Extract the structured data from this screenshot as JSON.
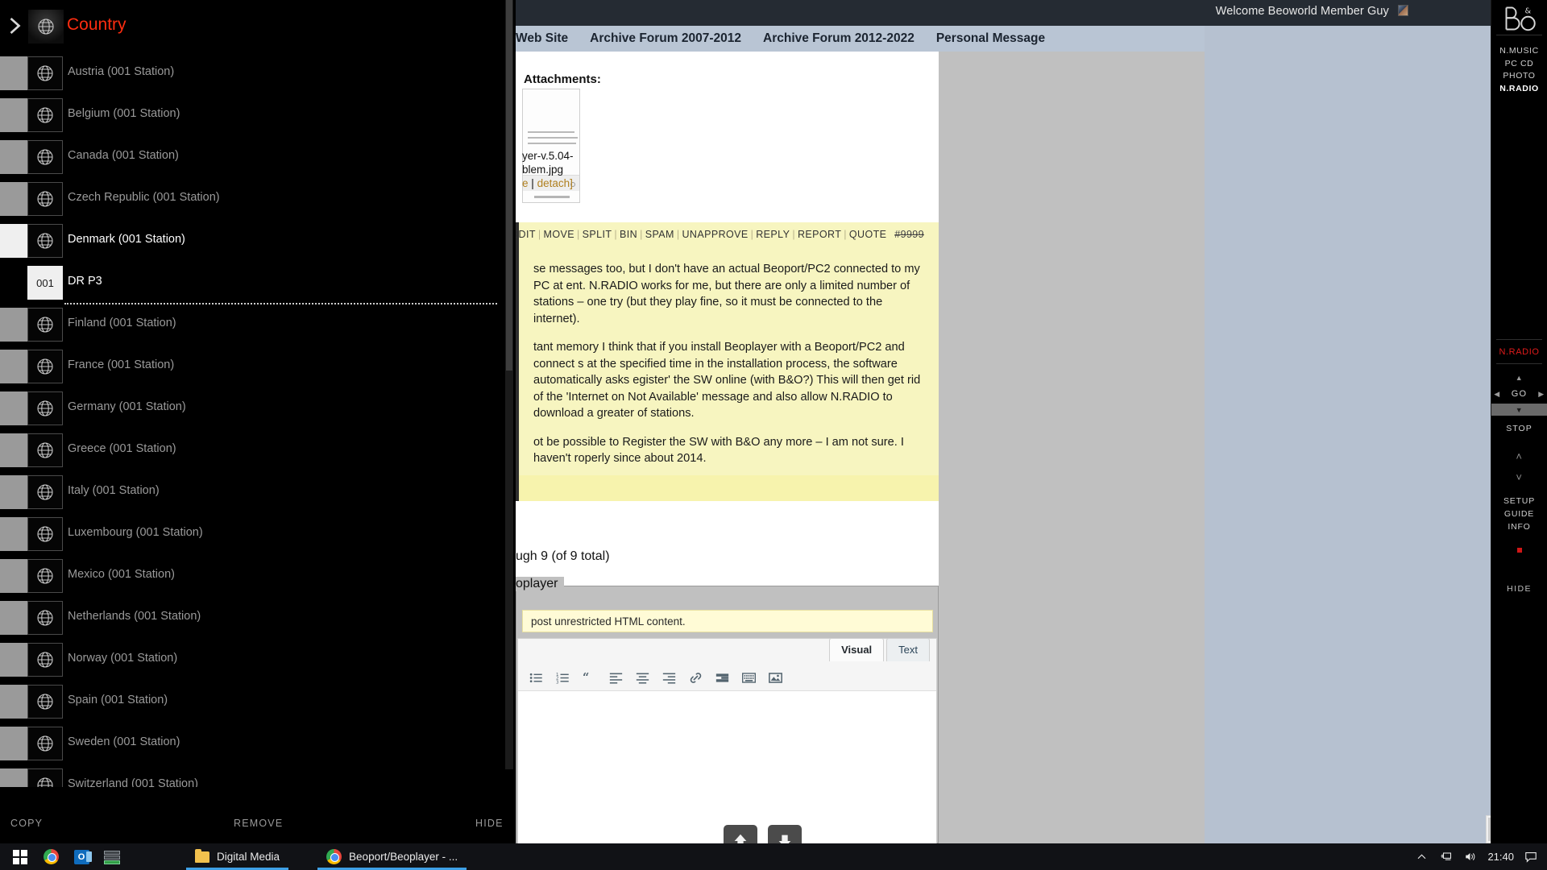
{
  "browser": {
    "topbar": {
      "welcome": "Welcome Beoworld Member Guy"
    },
    "nav": [
      {
        "label": "Web Site"
      },
      {
        "label": "Archive Forum 2007-2012"
      },
      {
        "label": "Archive Forum 2012-2022"
      },
      {
        "label": "Personal Message"
      }
    ],
    "attachments": {
      "heading": "Attachments:",
      "filename_line1": "yer-v.5.04-",
      "filename_line2": "blem.jpg",
      "actions_prefix": "e",
      "actions_sep": "|",
      "actions_detach": "detach]"
    },
    "post": {
      "actions": [
        "EDIT",
        "MOVE",
        "SPLIT",
        "BIN",
        "SPAM",
        "UNAPPROVE",
        "REPLY",
        "REPORT",
        "QUOTE"
      ],
      "anchor": "#9999",
      "paragraphs": [
        "se messages too, but I don't have an actual Beoport/PC2 connected to my PC at ent.  N.RADIO works for me, but there are only a limited number of stations – one try (but they play fine, so it must be connected to the internet).",
        "tant memory I think that if you install Beoplayer with a Beoport/PC2 and connect s at the specified time in the installation process, the software automatically asks egister' the SW online (with B&O?)  This will then get rid of the 'Internet on Not Available' message and also allow N.RADIO to download a greater of stations.",
        "ot be possible to Register the SW with B&O any more – I am not sure.  I haven't roperly since about 2014."
      ]
    },
    "pagination": "ugh 9 (of 9 total)",
    "reply": {
      "legend": "oplayer",
      "notice": "post unrestricted HTML content.",
      "tabs": [
        {
          "label": "Visual",
          "active": true
        },
        {
          "label": "Text",
          "active": false
        }
      ],
      "toolbar_icons": [
        "unordered-list-icon",
        "ordered-list-icon",
        "blockquote-icon",
        "align-left-icon",
        "align-center-icon",
        "align-right-icon",
        "link-icon",
        "insert-more-icon",
        "toolbar-toggle-icon",
        "add-media-icon"
      ]
    }
  },
  "bo_panel": {
    "logo": "B&O",
    "sources": [
      {
        "label": "N.MUSIC",
        "selected": false
      },
      {
        "label": "PC CD",
        "selected": false
      },
      {
        "label": "PHOTO",
        "selected": false
      },
      {
        "label": "N.RADIO",
        "selected": true
      }
    ],
    "now_playing": "N.RADIO",
    "go_label": "GO",
    "stop_label": "STOP",
    "menu": [
      "SETUP",
      "GUIDE",
      "INFO"
    ],
    "hide_label": "HIDE",
    "accent_red": "#e01b1b"
  },
  "beoplayer": {
    "title": "Country",
    "title_color": "#ff2d10",
    "rows": [
      {
        "label": "Austria (001 Station)",
        "type": "country",
        "selected": false
      },
      {
        "label": "Belgium (001 Station)",
        "type": "country",
        "selected": false
      },
      {
        "label": "Canada (001 Station)",
        "type": "country",
        "selected": false
      },
      {
        "label": "Czech Republic (001 Station)",
        "type": "country",
        "selected": false
      },
      {
        "label": "Denmark (001 Station)",
        "type": "country",
        "selected": true
      },
      {
        "label": "DR P3",
        "type": "station",
        "number": "001",
        "selected": false
      },
      {
        "label": "Finland (001 Station)",
        "type": "country",
        "selected": false
      },
      {
        "label": "France (001 Station)",
        "type": "country",
        "selected": false
      },
      {
        "label": "Germany (001 Station)",
        "type": "country",
        "selected": false
      },
      {
        "label": "Greece (001 Station)",
        "type": "country",
        "selected": false
      },
      {
        "label": "Italy (001 Station)",
        "type": "country",
        "selected": false
      },
      {
        "label": "Luxembourg (001 Station)",
        "type": "country",
        "selected": false
      },
      {
        "label": "Mexico (001 Station)",
        "type": "country",
        "selected": false
      },
      {
        "label": "Netherlands (001 Station)",
        "type": "country",
        "selected": false
      },
      {
        "label": "Norway (001 Station)",
        "type": "country",
        "selected": false
      },
      {
        "label": "Spain (001 Station)",
        "type": "country",
        "selected": false
      },
      {
        "label": "Sweden (001 Station)",
        "type": "country",
        "selected": false
      },
      {
        "label": "Switzerland (001 Station)",
        "type": "country",
        "selected": false
      }
    ],
    "footer": {
      "copy": "COPY",
      "remove": "REMOVE",
      "hide": "HIDE"
    }
  },
  "taskbar": {
    "system_icons": [
      "windows-start-icon",
      "chrome-icon",
      "outlook-icon",
      "remote-desktop-icon"
    ],
    "tasks": [
      {
        "label": "Digital Media",
        "icon": "folder-icon",
        "active": true
      },
      {
        "label": "Beoport/Beoplayer - ...",
        "icon": "chrome-icon",
        "active": true
      }
    ],
    "clock": "21:40",
    "tray_icons": [
      "show-hidden-icons-chevron",
      "network-icon",
      "volume-icon",
      "notifications-icon"
    ]
  }
}
